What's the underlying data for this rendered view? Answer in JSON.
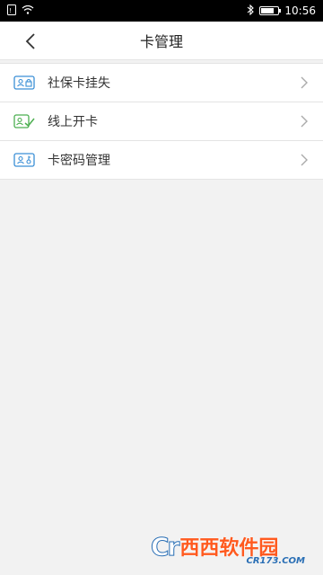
{
  "status_bar": {
    "time": "10:56",
    "battery_percent": 75
  },
  "header": {
    "title": "卡管理"
  },
  "menu": {
    "items": [
      {
        "label": "社保卡挂失",
        "icon": "card-lock-icon",
        "color": "#3a8fd6"
      },
      {
        "label": "线上开卡",
        "icon": "card-check-icon",
        "color": "#4caf50"
      },
      {
        "label": "卡密码管理",
        "icon": "card-key-icon",
        "color": "#3a8fd6"
      }
    ]
  },
  "watermark": {
    "brand": "西西软件园",
    "url": "CR173.COM"
  }
}
